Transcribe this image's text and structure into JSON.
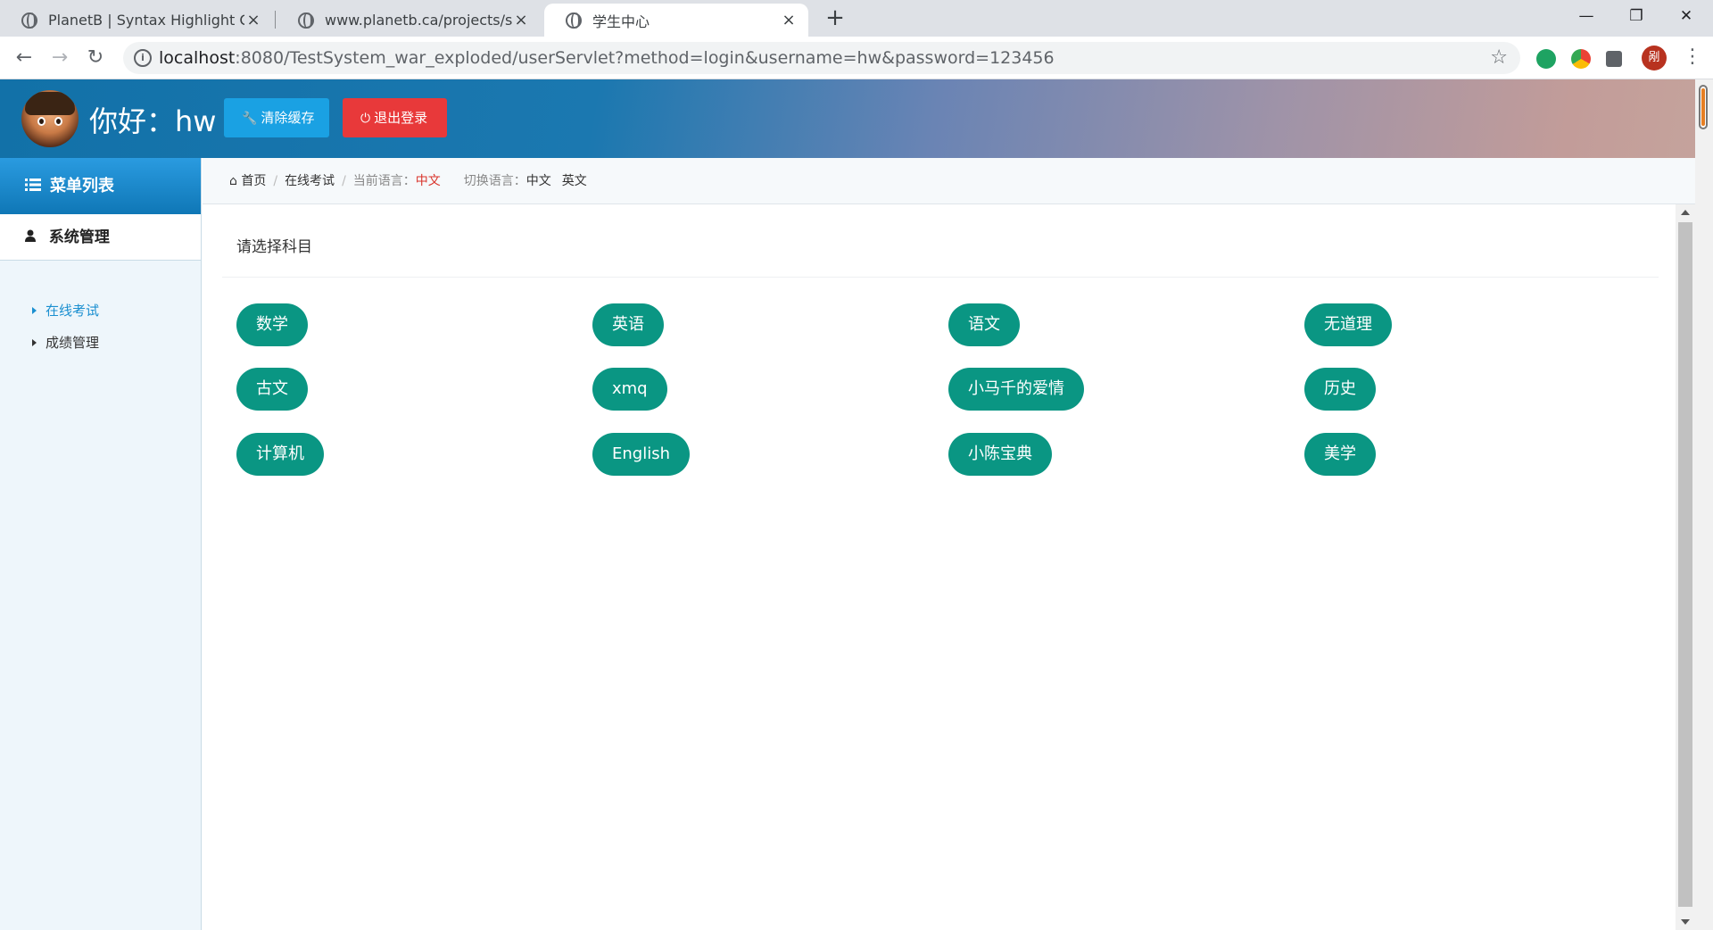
{
  "browser": {
    "tabs": [
      {
        "title": "PlanetB | Syntax Highlight Code",
        "close": "×"
      },
      {
        "title": "www.planetb.ca/projects/syntax",
        "close": "×"
      },
      {
        "title": "学生中心",
        "close": "×"
      }
    ],
    "new_tab": "+",
    "window_controls": {
      "minimize": "—",
      "maximize": "❐",
      "close": "✕"
    },
    "url_host": "localhost",
    "url_rest": ":8080/TestSystem_war_exploded/userServlet?method=login&username=hw&password=123456",
    "profile_initial": "剐"
  },
  "header": {
    "greeting": "你好：hw",
    "clear_cache_label": "清除缓存",
    "logout_label": "退出登录"
  },
  "sidebar": {
    "title": "菜单列表",
    "section": "系统管理",
    "items": [
      {
        "label": "在线考试",
        "active": true
      },
      {
        "label": "成绩管理",
        "active": false
      }
    ]
  },
  "breadcrumb": {
    "home": "首页",
    "current": "在线考试",
    "lang_label": "当前语言：",
    "lang_value": "中文",
    "switch_label": "切换语言：",
    "switch_options": [
      "中文",
      "英文"
    ]
  },
  "content": {
    "title": "请选择科目",
    "subjects": [
      "数学",
      "英语",
      "语文",
      "无道理",
      "古文",
      "xmq",
      "小马千的爱情",
      "历史",
      "计算机",
      "English",
      "小陈宝典",
      "美学"
    ]
  },
  "colors": {
    "subject_button": "#0a9683",
    "clear_button": "#1aa1e3",
    "logout_button": "#e8393a",
    "active_link": "#1a8fd0",
    "current_lang": "#d9342b"
  }
}
